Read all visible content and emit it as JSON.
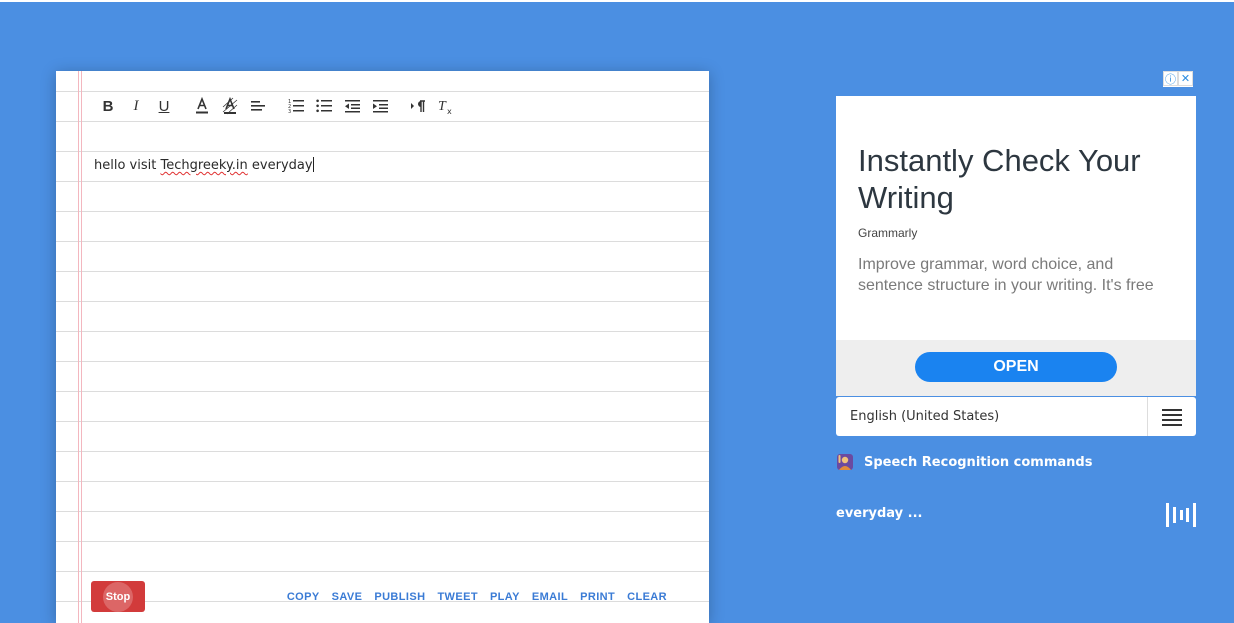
{
  "toolbar": {
    "buttons": [
      "bold-icon",
      "italic-icon",
      "underline-icon",
      "font-color-icon",
      "highlight-icon",
      "align-left-icon",
      "ordered-list-icon",
      "bullet-list-icon",
      "outdent-icon",
      "indent-icon",
      "paragraph-direction-icon",
      "clear-format-icon"
    ],
    "bold": "B",
    "italic": "I",
    "underline": "U",
    "clear_format": "Tx"
  },
  "editor": {
    "text_before": "hello visit ",
    "misspelled": "Techgreeky.in",
    "text_after": " everyday"
  },
  "stop_button": {
    "label": "Stop",
    "color": "#d23b3b"
  },
  "actions": [
    "COPY",
    "SAVE",
    "PUBLISH",
    "TWEET",
    "PLAY",
    "EMAIL",
    "PRINT",
    "CLEAR"
  ],
  "ad": {
    "headline": "Instantly Check Your Writing",
    "brand": "Grammarly",
    "description": "Improve grammar, word choice, and sentence structure in your writing. It's free",
    "cta": "OPEN",
    "info_badge": "ⓘ",
    "close_badge": "✕"
  },
  "language": {
    "selected": "English (United States)"
  },
  "speech_commands": {
    "label": "Speech Recognition commands"
  },
  "live_transcript": "everyday ...",
  "colors": {
    "background": "#4b8fe2",
    "accent": "#3a7bd5",
    "cta": "#1a83f0"
  }
}
